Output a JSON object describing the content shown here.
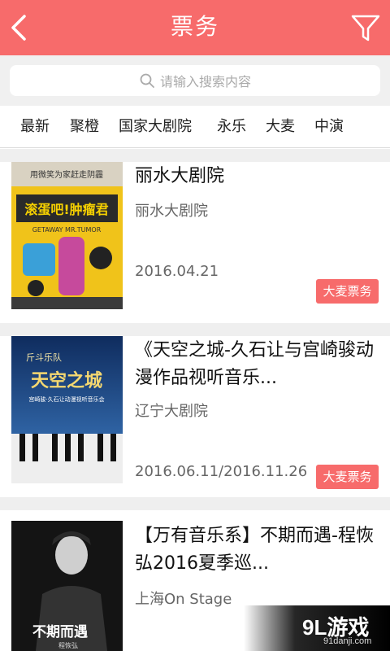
{
  "header": {
    "title": "票务",
    "back_icon": "chevron-left-icon",
    "filter_icon": "funnel-filter-icon",
    "color": "#f76b6b"
  },
  "search": {
    "placeholder": "请输入搜索内容"
  },
  "tabs": [
    {
      "label": "最新"
    },
    {
      "label": "聚橙"
    },
    {
      "label": "国家大剧院"
    },
    {
      "label": "永乐"
    },
    {
      "label": "大麦"
    },
    {
      "label": "中演"
    }
  ],
  "events": [
    {
      "title": "丽水大剧院",
      "venue": "丽水大剧院",
      "date": "2016.04.21",
      "badge": "大麦票务",
      "poster": {
        "top_text": "用微笑为家赶走阴霾",
        "main_text": "滚蛋吧!肿瘤君",
        "en_text": "GETAWAY MR.TUMOR"
      }
    },
    {
      "title": "《天空之城-久石让与宫崎骏动漫作品视听音乐...",
      "venue": "辽宁大剧院",
      "date": "2016.06.11/2016.11.26",
      "badge": "大麦票务",
      "poster": {
        "top_text": "斤斗乐队",
        "main_text": "天空之城",
        "sub_text": "宫崎骏·久石让动漫视听音乐会"
      }
    },
    {
      "title": "【万有音乐系】不期而遇-程恢弘2016夏季巡...",
      "venue": "上海On Stage",
      "poster": {
        "main_text": "不期而遇",
        "sub_text": "程恢弘"
      }
    }
  ],
  "watermark": {
    "logo": "9L游戏",
    "url": "91danji.com"
  }
}
